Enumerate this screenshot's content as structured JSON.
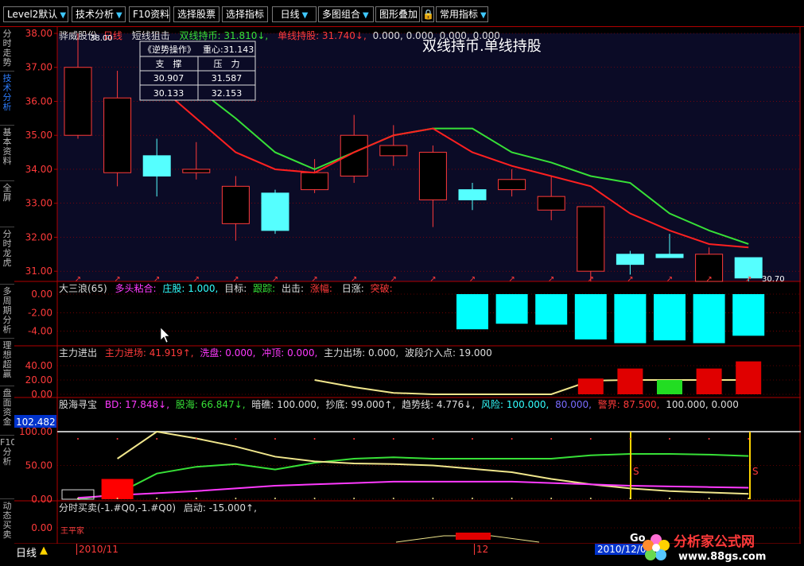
{
  "toolbar": {
    "level2": "Level2默认",
    "tech": "技术分析",
    "f10": "F10资料",
    "stocks": "选择股票",
    "indicators": "选择指标",
    "period": "日线",
    "multi": "多图组合",
    "overlay": "图形叠加",
    "common": "常用指标"
  },
  "lefttabs": [
    "分时走势",
    "技术分析",
    "基本资料",
    "全屏",
    "分时龙虎",
    "多周期分析",
    "理想超赢",
    "盘面资金",
    "F10分析",
    "动态买卖"
  ],
  "panel1": {
    "stock": "骅威股份",
    "period": "日线",
    "formula": "短线狙击",
    "l1": "双线持币: 31.810↓,",
    "l2": "单线持股: 31.740↓,",
    "l3": "0.000, 0.000, 0.000, 0.000,",
    "banner": "双线持币.单线持股",
    "high_label": "38.00",
    "low_label": "30.70",
    "yticks": [
      "38.00",
      "37.00",
      "36.00",
      "35.00",
      "34.00",
      "33.00",
      "32.00",
      "31.00"
    ]
  },
  "info_box": {
    "title": "《逆势操作》",
    "center": "重心:31.143",
    "h1": "支　撑",
    "h2": "压　力",
    "r1c1": "30.907",
    "r1c2": "31.587",
    "r2c1": "30.133",
    "r2c2": "32.153"
  },
  "panel2": {
    "name": "大三浪(65)",
    "a": "多头粘合:",
    "b": "庄股: 1.000,",
    "c": "目标:",
    "d": "跟踪:",
    "e": "出击:",
    "f": "涨幅:",
    "g": "日涨:",
    "h": "突破:",
    "yticks": [
      "0.00",
      "-2.00",
      "-4.00"
    ]
  },
  "panel3": {
    "name": "主力进出",
    "a": "主力进场: 41.919↑,",
    "b": "洗盘: 0.000,",
    "c": "冲顶: 0.000,",
    "d": "主力出场: 0.000,",
    "e": "波段介入点: 19.000",
    "yticks": [
      "40.00",
      "20.00",
      "0.00"
    ]
  },
  "panel4": {
    "name": "股海寻宝",
    "a": "BD: 17.848↓,",
    "b": "股海: 66.847↓,",
    "c": "暗礁: 100.000,",
    "d": "抄底: 99.000↑,",
    "e": "趋势线: 4.776↓,",
    "f": "风险: 100.000,",
    "g": "80.000,",
    "h": "警界: 87.500,",
    "i": "100.000, 0.000",
    "value_box": "102.482",
    "yticks": [
      "100.00",
      "50.00",
      "0.00"
    ],
    "s_mark": "S"
  },
  "panel5": {
    "name": "分时买卖(-1.#Q0,-1.#Q0)",
    "a": "启动: -15.000↑,",
    "ytick": "0.00",
    "label": "王平家"
  },
  "status": {
    "period": "日线",
    "date1": "2010/11",
    "date2": "12",
    "date3": "2010/12/06",
    "logo": "Go"
  },
  "watermark": {
    "name": "分析家公式网",
    "url": "www.88gs.com"
  },
  "chart_data": {
    "type": "candlestick",
    "candles": [
      {
        "o": 35.0,
        "c": 37.0,
        "h": 38.0,
        "l": 34.9
      },
      {
        "o": 33.9,
        "c": 36.1,
        "h": 36.9,
        "l": 33.5
      },
      {
        "o": 34.4,
        "c": 33.8,
        "h": 34.9,
        "l": 33.2
      },
      {
        "o": 33.9,
        "c": 34.0,
        "h": 34.8,
        "l": 33.7
      },
      {
        "o": 32.4,
        "c": 33.5,
        "h": 33.8,
        "l": 31.9
      },
      {
        "o": 33.3,
        "c": 32.2,
        "h": 33.4,
        "l": 32.1
      },
      {
        "o": 33.4,
        "c": 33.9,
        "h": 34.3,
        "l": 33.3
      },
      {
        "o": 33.8,
        "c": 35.0,
        "h": 35.6,
        "l": 33.6
      },
      {
        "o": 34.4,
        "c": 34.7,
        "h": 35.3,
        "l": 34.1
      },
      {
        "o": 33.1,
        "c": 34.5,
        "h": 34.7,
        "l": 32.3
      },
      {
        "o": 33.4,
        "c": 33.1,
        "h": 33.6,
        "l": 32.8
      },
      {
        "o": 33.4,
        "c": 33.7,
        "h": 34.0,
        "l": 33.2
      },
      {
        "o": 32.8,
        "c": 33.2,
        "h": 33.8,
        "l": 32.5
      },
      {
        "o": 31.0,
        "c": 32.9,
        "h": 32.9,
        "l": 30.7
      },
      {
        "o": 31.5,
        "c": 31.2,
        "h": 31.6,
        "l": 30.9
      },
      {
        "o": 31.5,
        "c": 31.4,
        "h": 32.1,
        "l": 31.4
      },
      {
        "o": 30.7,
        "c": 31.5,
        "h": 31.7,
        "l": 30.7
      },
      {
        "o": 31.4,
        "c": 30.8,
        "h": 31.4,
        "l": 30.7
      }
    ],
    "green_line": [
      null,
      null,
      null,
      36.4,
      35.5,
      34.5,
      34.0,
      34.5,
      35.0,
      35.2,
      35.2,
      34.5,
      34.2,
      33.8,
      33.6,
      32.7,
      32.2,
      31.8
    ],
    "red_line": [
      null,
      null,
      36.5,
      35.5,
      34.5,
      34.0,
      33.9,
      34.5,
      35.0,
      35.2,
      34.5,
      34.1,
      33.8,
      33.5,
      32.7,
      32.2,
      31.8,
      31.7
    ],
    "y_range": [
      30.7,
      38.0
    ],
    "wave_bars": [
      null,
      null,
      null,
      null,
      null,
      null,
      null,
      null,
      null,
      null,
      -3.8,
      -3.2,
      -3.3,
      -4.9,
      -5.3,
      -5.0,
      -5.3,
      -4.5
    ],
    "main_force_line": [
      null,
      null,
      null,
      null,
      null,
      null,
      20.0,
      10.0,
      2.0,
      0.0,
      0.0,
      0.0,
      0.0,
      19.0,
      20.0,
      20.0,
      20.0,
      20.0
    ],
    "main_force_bars": [
      null,
      null,
      null,
      null,
      null,
      null,
      null,
      null,
      null,
      null,
      null,
      null,
      null,
      22,
      36,
      20,
      36,
      46
    ],
    "main_force_bar_colors": [
      "",
      "",
      "",
      "",
      "",
      "",
      "",
      "",
      "",
      "",
      "",
      "",
      "",
      "red",
      "red",
      "green",
      "red",
      "red"
    ]
  }
}
